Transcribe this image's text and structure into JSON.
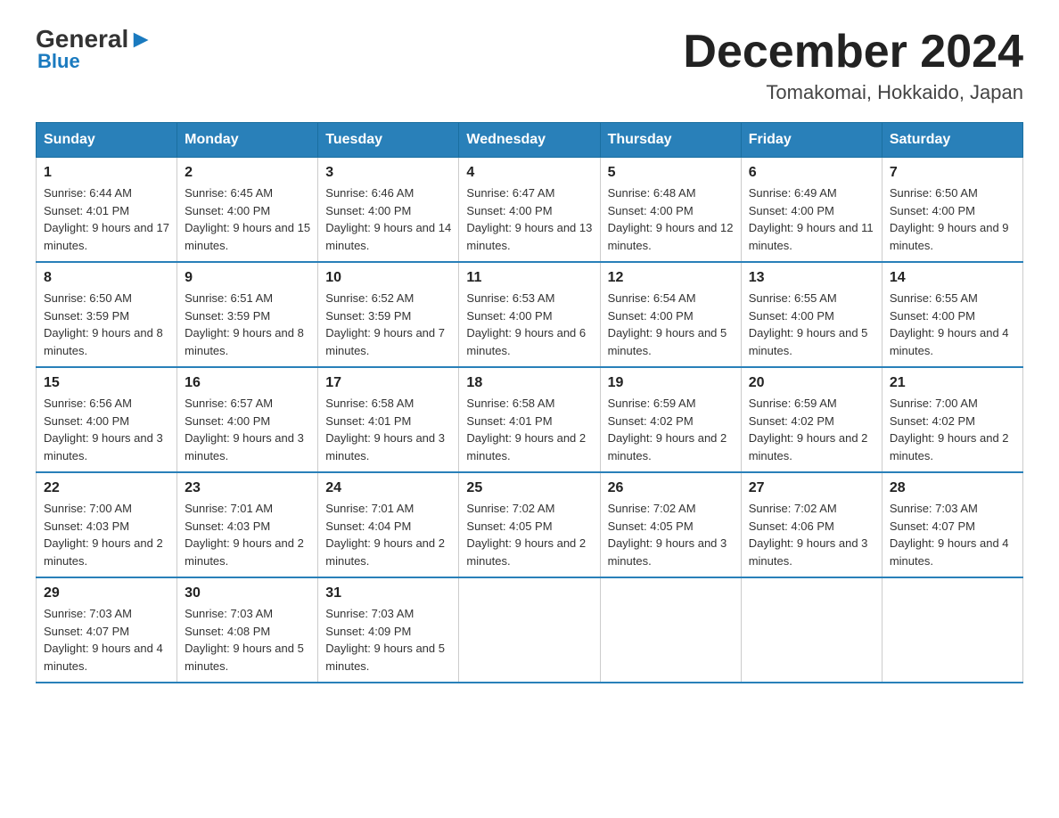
{
  "header": {
    "logo_general": "General",
    "logo_blue": "Blue",
    "month_year": "December 2024",
    "location": "Tomakomai, Hokkaido, Japan"
  },
  "days_of_week": [
    "Sunday",
    "Monday",
    "Tuesday",
    "Wednesday",
    "Thursday",
    "Friday",
    "Saturday"
  ],
  "weeks": [
    [
      {
        "day": "1",
        "sunrise": "6:44 AM",
        "sunset": "4:01 PM",
        "daylight": "9 hours and 17 minutes."
      },
      {
        "day": "2",
        "sunrise": "6:45 AM",
        "sunset": "4:00 PM",
        "daylight": "9 hours and 15 minutes."
      },
      {
        "day": "3",
        "sunrise": "6:46 AM",
        "sunset": "4:00 PM",
        "daylight": "9 hours and 14 minutes."
      },
      {
        "day": "4",
        "sunrise": "6:47 AM",
        "sunset": "4:00 PM",
        "daylight": "9 hours and 13 minutes."
      },
      {
        "day": "5",
        "sunrise": "6:48 AM",
        "sunset": "4:00 PM",
        "daylight": "9 hours and 12 minutes."
      },
      {
        "day": "6",
        "sunrise": "6:49 AM",
        "sunset": "4:00 PM",
        "daylight": "9 hours and 11 minutes."
      },
      {
        "day": "7",
        "sunrise": "6:50 AM",
        "sunset": "4:00 PM",
        "daylight": "9 hours and 9 minutes."
      }
    ],
    [
      {
        "day": "8",
        "sunrise": "6:50 AM",
        "sunset": "3:59 PM",
        "daylight": "9 hours and 8 minutes."
      },
      {
        "day": "9",
        "sunrise": "6:51 AM",
        "sunset": "3:59 PM",
        "daylight": "9 hours and 8 minutes."
      },
      {
        "day": "10",
        "sunrise": "6:52 AM",
        "sunset": "3:59 PM",
        "daylight": "9 hours and 7 minutes."
      },
      {
        "day": "11",
        "sunrise": "6:53 AM",
        "sunset": "4:00 PM",
        "daylight": "9 hours and 6 minutes."
      },
      {
        "day": "12",
        "sunrise": "6:54 AM",
        "sunset": "4:00 PM",
        "daylight": "9 hours and 5 minutes."
      },
      {
        "day": "13",
        "sunrise": "6:55 AM",
        "sunset": "4:00 PM",
        "daylight": "9 hours and 5 minutes."
      },
      {
        "day": "14",
        "sunrise": "6:55 AM",
        "sunset": "4:00 PM",
        "daylight": "9 hours and 4 minutes."
      }
    ],
    [
      {
        "day": "15",
        "sunrise": "6:56 AM",
        "sunset": "4:00 PM",
        "daylight": "9 hours and 3 minutes."
      },
      {
        "day": "16",
        "sunrise": "6:57 AM",
        "sunset": "4:00 PM",
        "daylight": "9 hours and 3 minutes."
      },
      {
        "day": "17",
        "sunrise": "6:58 AM",
        "sunset": "4:01 PM",
        "daylight": "9 hours and 3 minutes."
      },
      {
        "day": "18",
        "sunrise": "6:58 AM",
        "sunset": "4:01 PM",
        "daylight": "9 hours and 2 minutes."
      },
      {
        "day": "19",
        "sunrise": "6:59 AM",
        "sunset": "4:02 PM",
        "daylight": "9 hours and 2 minutes."
      },
      {
        "day": "20",
        "sunrise": "6:59 AM",
        "sunset": "4:02 PM",
        "daylight": "9 hours and 2 minutes."
      },
      {
        "day": "21",
        "sunrise": "7:00 AM",
        "sunset": "4:02 PM",
        "daylight": "9 hours and 2 minutes."
      }
    ],
    [
      {
        "day": "22",
        "sunrise": "7:00 AM",
        "sunset": "4:03 PM",
        "daylight": "9 hours and 2 minutes."
      },
      {
        "day": "23",
        "sunrise": "7:01 AM",
        "sunset": "4:03 PM",
        "daylight": "9 hours and 2 minutes."
      },
      {
        "day": "24",
        "sunrise": "7:01 AM",
        "sunset": "4:04 PM",
        "daylight": "9 hours and 2 minutes."
      },
      {
        "day": "25",
        "sunrise": "7:02 AM",
        "sunset": "4:05 PM",
        "daylight": "9 hours and 2 minutes."
      },
      {
        "day": "26",
        "sunrise": "7:02 AM",
        "sunset": "4:05 PM",
        "daylight": "9 hours and 3 minutes."
      },
      {
        "day": "27",
        "sunrise": "7:02 AM",
        "sunset": "4:06 PM",
        "daylight": "9 hours and 3 minutes."
      },
      {
        "day": "28",
        "sunrise": "7:03 AM",
        "sunset": "4:07 PM",
        "daylight": "9 hours and 4 minutes."
      }
    ],
    [
      {
        "day": "29",
        "sunrise": "7:03 AM",
        "sunset": "4:07 PM",
        "daylight": "9 hours and 4 minutes."
      },
      {
        "day": "30",
        "sunrise": "7:03 AM",
        "sunset": "4:08 PM",
        "daylight": "9 hours and 5 minutes."
      },
      {
        "day": "31",
        "sunrise": "7:03 AM",
        "sunset": "4:09 PM",
        "daylight": "9 hours and 5 minutes."
      },
      null,
      null,
      null,
      null
    ]
  ]
}
